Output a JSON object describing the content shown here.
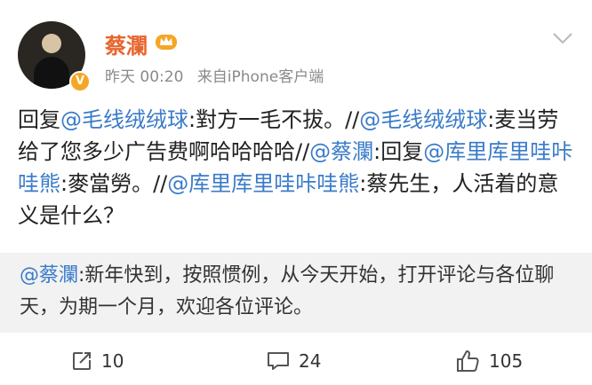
{
  "post": {
    "author": {
      "name": "蔡瀾",
      "vip_badge": "V",
      "time": "昨天 00:20",
      "source": "来自iPhone客户端"
    },
    "content": {
      "prefix_1": "回复",
      "mention_1": "@毛线绒绒球",
      "text_1": ":對方一毛不拔。//",
      "mention_2": "@毛线绒绒球",
      "text_2": ":麦当劳给了您多少广告费啊哈哈哈哈//",
      "mention_3": "@蔡瀾",
      "text_3": ":回复",
      "mention_4": "@库里库里哇咔哇熊",
      "text_4": ":麥當勞。//",
      "mention_5": "@库里库里哇咔哇熊",
      "text_5": ":蔡先生，人活着的意义是什么？"
    },
    "quote": {
      "mention": "@蔡瀾",
      "text": ":新年快到，按照惯例，从今天开始，打开评论与各位聊天，为期一个月，欢迎各位评论。"
    },
    "actions": {
      "repost_count": "10",
      "comment_count": "24",
      "like_count": "105"
    },
    "colors": {
      "username": "#e8652c",
      "mention": "#3a7bc8",
      "quote_bg": "#f2f2f2",
      "crown": "#f5a623"
    }
  }
}
